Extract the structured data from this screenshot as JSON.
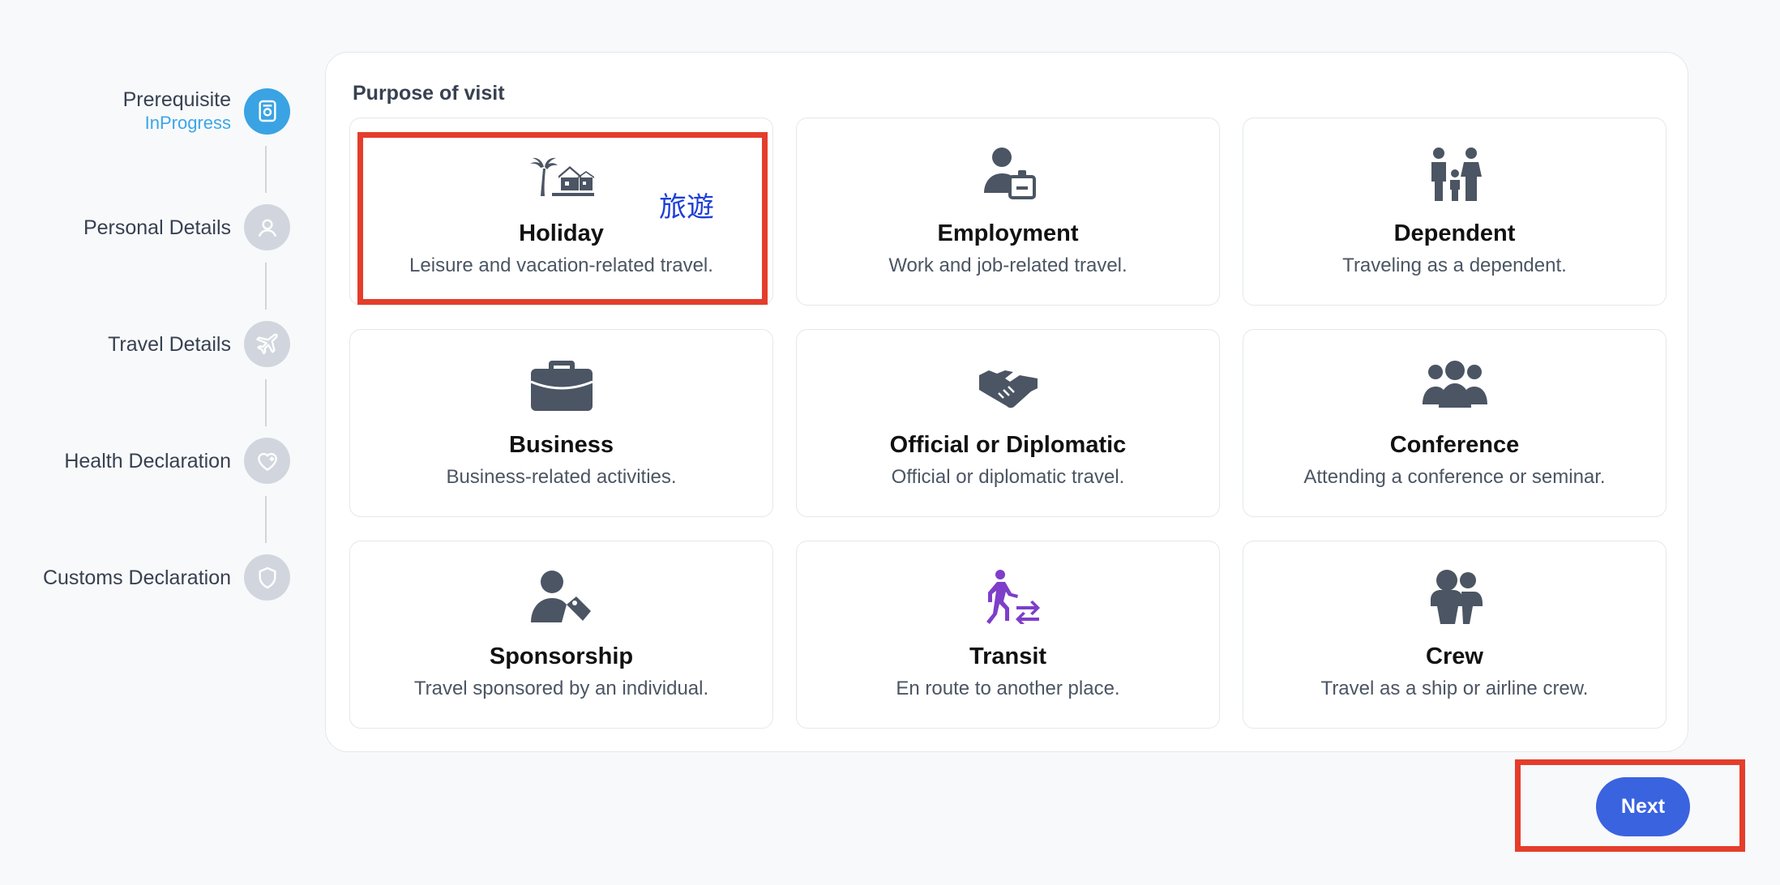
{
  "stepper": {
    "steps": [
      {
        "label": "Prerequisite",
        "status": "InProgress",
        "icon": "passport-icon"
      },
      {
        "label": "Personal Details",
        "status": "",
        "icon": "user-icon"
      },
      {
        "label": "Travel Details",
        "status": "",
        "icon": "plane-icon"
      },
      {
        "label": "Health Declaration",
        "status": "",
        "icon": "heart-plus-icon"
      },
      {
        "label": "Customs Declaration",
        "status": "",
        "icon": "shield-icon"
      }
    ]
  },
  "purpose": {
    "title": "Purpose of visit",
    "options": [
      {
        "title": "Holiday",
        "desc": "Leisure and vacation-related travel.",
        "icon": "palm-house-icon",
        "annotation": "旅遊"
      },
      {
        "title": "Employment",
        "desc": "Work and job-related travel.",
        "icon": "worker-icon"
      },
      {
        "title": "Dependent",
        "desc": "Traveling as a dependent.",
        "icon": "family-icon"
      },
      {
        "title": "Business",
        "desc": "Business-related activities.",
        "icon": "briefcase-icon"
      },
      {
        "title": "Official or Diplomatic",
        "desc": "Official or diplomatic travel.",
        "icon": "handshake-icon"
      },
      {
        "title": "Conference",
        "desc": "Attending a conference or seminar.",
        "icon": "group-icon"
      },
      {
        "title": "Sponsorship",
        "desc": "Travel sponsored by an individual.",
        "icon": "user-tag-icon"
      },
      {
        "title": "Transit",
        "desc": "En route to another place.",
        "icon": "person-transfer-icon"
      },
      {
        "title": "Crew",
        "desc": "Travel as a ship or airline crew.",
        "icon": "crew-icon"
      }
    ]
  },
  "actions": {
    "next_label": "Next"
  },
  "colors": {
    "accent": "#3aa3e3",
    "button": "#3a63e0",
    "highlight": "#e53d2b",
    "transit_icon": "#7e3ec9",
    "icon": "#4b5563"
  }
}
